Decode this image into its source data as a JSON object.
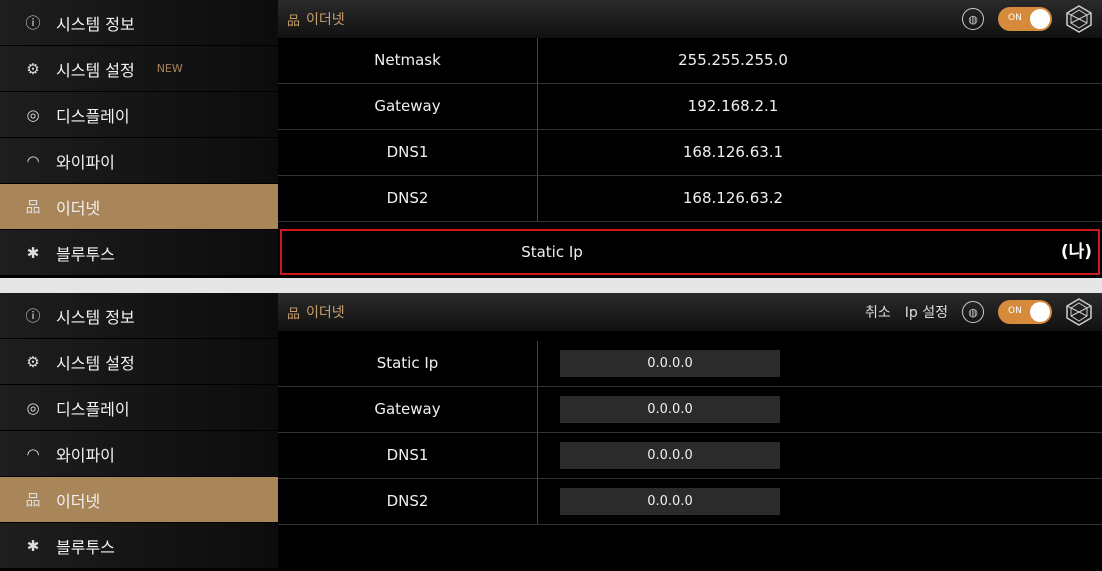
{
  "top": {
    "sidebar": [
      {
        "icon": "ⓘ",
        "label": "시스템 정보"
      },
      {
        "icon": "⚙",
        "label": "시스템 설정",
        "badge": "NEW"
      },
      {
        "icon": "◎",
        "label": "디스플레이"
      },
      {
        "icon": "◠",
        "label": "와이파이"
      },
      {
        "icon": "品",
        "label": "이더넷"
      },
      {
        "icon": "✱",
        "label": "블루투스"
      }
    ],
    "header": {
      "icon": "品",
      "title": "이더넷",
      "toggle": "ON"
    },
    "rows": [
      {
        "label": "Netmask",
        "value": "255.255.255.0"
      },
      {
        "label": "Gateway",
        "value": "192.168.2.1"
      },
      {
        "label": "DNS1",
        "value": "168.126.63.1"
      },
      {
        "label": "DNS2",
        "value": "168.126.63.2"
      }
    ],
    "static_button": "Static Ip",
    "marker": "(나)"
  },
  "bottom": {
    "sidebar": [
      {
        "icon": "ⓘ",
        "label": "시스템 정보"
      },
      {
        "icon": "⚙",
        "label": "시스템 설정"
      },
      {
        "icon": "◎",
        "label": "디스플레이"
      },
      {
        "icon": "◠",
        "label": "와이파이"
      },
      {
        "icon": "品",
        "label": "이더넷"
      },
      {
        "icon": "✱",
        "label": "블루투스"
      }
    ],
    "header": {
      "icon": "品",
      "title": "이더넷",
      "cancel": "취소",
      "ip_setting": "Ip 설정",
      "toggle": "ON"
    },
    "rows": [
      {
        "label": "Static Ip",
        "value": "0.0.0.0"
      },
      {
        "label": "Gateway",
        "value": "0.0.0.0"
      },
      {
        "label": "DNS1",
        "value": "0.0.0.0"
      },
      {
        "label": "DNS2",
        "value": "0.0.0.0"
      }
    ]
  },
  "icons": {
    "info": "info-icon",
    "gear": "gear-icon",
    "display": "display-icon",
    "wifi": "wifi-icon",
    "ethernet": "ethernet-icon",
    "bluetooth": "bluetooth-icon"
  },
  "colors": {
    "accent": "#a9855a",
    "header_text": "#c9a06c",
    "toggle": "#d68a3c",
    "highlight_border": "#d01818"
  }
}
